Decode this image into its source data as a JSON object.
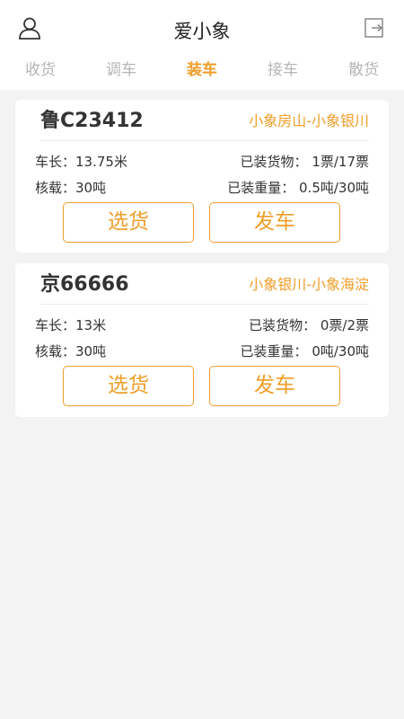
{
  "header": {
    "title": "爱小象",
    "user_icon": "user-icon",
    "exit_icon": "logout-icon"
  },
  "tabs": [
    {
      "label": "收货",
      "active": false
    },
    {
      "label": "调车",
      "active": false
    },
    {
      "label": "装车",
      "active": true
    },
    {
      "label": "接车",
      "active": false
    },
    {
      "label": "散货",
      "active": false
    }
  ],
  "colors": {
    "accent": "#ef9e2a",
    "background": "#f3f3f3",
    "inactive_tab": "#b5b5b5"
  },
  "vehicles": [
    {
      "plate": "鲁C23412",
      "route": "小象房山-小象银川",
      "length": "车长：13.75米",
      "capacity": "核载：30吨",
      "loaded_goods": "已装货物：  1票/17票",
      "loaded_weight": "已装重量：  0.5吨/30吨",
      "pick_label": "选货",
      "depart_label": "发车"
    },
    {
      "plate": "京66666",
      "route": "小象银川-小象海淀",
      "length": "车长：13米",
      "capacity": "核载：30吨",
      "loaded_goods": "已装货物：  0票/2票",
      "loaded_weight": "已装重量：  0吨/30吨",
      "pick_label": "选货",
      "depart_label": "发车"
    }
  ]
}
